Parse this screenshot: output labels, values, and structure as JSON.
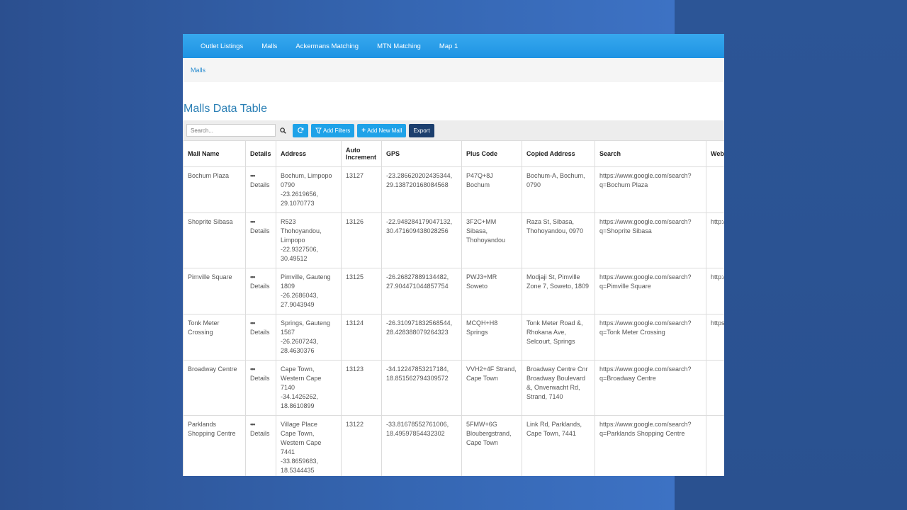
{
  "nav": {
    "items": [
      "Outlet Listings",
      "Malls",
      "Ackermans Matching",
      "MTN Matching",
      "Map 1"
    ]
  },
  "breadcrumb": "Malls",
  "page_title": "Malls Data Table",
  "toolbar": {
    "search_placeholder": "Search...",
    "add_filters": "Add Filters",
    "add_new_mall": "Add New Mall",
    "export": "Export"
  },
  "table": {
    "headers": [
      "Mall Name",
      "Details",
      "Address",
      "Auto Increment",
      "GPS",
      "Plus Code",
      "Copied Address",
      "Search",
      "Website"
    ],
    "rows": [
      {
        "mall_name": "Bochum Plaza",
        "details": "Details",
        "address": [
          "Bochum, Limpopo",
          "0790",
          "-23.2619656,",
          "29.1070773"
        ],
        "auto_increment": "13127",
        "gps": [
          "-23.286620202435344,",
          "29.138720168084568"
        ],
        "plus_code": [
          "P47Q+8J",
          "Bochum"
        ],
        "copied_address": [
          "Bochum-A, Bochum,",
          "0790"
        ],
        "search": [
          "https://www.google.com/search?",
          "q=Bochum Plaza"
        ],
        "website": ""
      },
      {
        "mall_name": "Shoprite Sibasa",
        "details": "Details",
        "address": [
          "R523",
          "Thohoyandou,",
          "Limpopo",
          "-22.9327506,",
          "30.49512"
        ],
        "auto_increment": "13126",
        "gps": [
          "-22.948284179047132,",
          "30.471609438028256"
        ],
        "plus_code": [
          "3F2C+MM",
          "Sibasa,",
          "Thohoyandou"
        ],
        "copied_address": [
          "Raza St, Sibasa,",
          "Thohoyandou, 0970"
        ],
        "search": [
          "https://www.google.com/search?",
          "q=Shoprite Sibasa"
        ],
        "website": "http:/"
      },
      {
        "mall_name": "Pimville Square",
        "details": "Details",
        "address": [
          "Pimville, Gauteng",
          "1809",
          "-26.2686043,",
          "27.9043949"
        ],
        "auto_increment": "13125",
        "gps": [
          "-26.26827889134482,",
          "27.904471044857754"
        ],
        "plus_code": [
          "PWJ3+MR",
          "Soweto"
        ],
        "copied_address": [
          "Modjaji St, Pimville",
          "Zone 7, Soweto, 1809"
        ],
        "search": [
          "https://www.google.com/search?",
          "q=Pimville Square"
        ],
        "website": "http:/"
      },
      {
        "mall_name": "Tonk Meter Crossing",
        "details": "Details",
        "address": [
          "Springs, Gauteng",
          "1567",
          "-26.2607243,",
          "28.4630376"
        ],
        "auto_increment": "13124",
        "gps": [
          "-26.310971832568544,",
          "28.428388079264323"
        ],
        "plus_code": [
          "MCQH+H8",
          "Springs"
        ],
        "copied_address": [
          "Tonk Meter Road &,",
          "Rhokana Ave,",
          "Selcourt, Springs"
        ],
        "search": [
          "https://www.google.com/search?",
          "q=Tonk Meter Crossing"
        ],
        "website": "https:"
      },
      {
        "mall_name": "Broadway Centre",
        "details": "Details",
        "address": [
          "Cape Town,",
          "Western Cape",
          "7140",
          "-34.1426262,",
          "18.8610899"
        ],
        "auto_increment": "13123",
        "gps": [
          "-34.12247853217184,",
          "18.851562794309572"
        ],
        "plus_code": [
          "VVH2+4F Strand,",
          "Cape Town"
        ],
        "copied_address": [
          "Broadway Centre Cnr",
          "Broadway Boulevard",
          "&, Onverwacht Rd,",
          "Strand, 7140"
        ],
        "search": [
          "https://www.google.com/search?",
          "q=Broadway Centre"
        ],
        "website": ""
      },
      {
        "mall_name": "Parklands Shopping Centre",
        "details": "Details",
        "address": [
          "Village Place",
          "Cape Town,",
          "Western Cape",
          "7441",
          "-33.8659683,",
          "18.5344435"
        ],
        "auto_increment": "13122",
        "gps": [
          "-33.81678552761006,",
          "18.49597854432302"
        ],
        "plus_code": [
          "5FMW+6G",
          "Bloubergstrand,",
          "Cape Town"
        ],
        "copied_address": [
          "Link Rd, Parklands,",
          "Cape Town, 7441"
        ],
        "search": [
          "https://www.google.com/search?",
          "q=Parklands Shopping Centre"
        ],
        "website": ""
      }
    ]
  },
  "colors": {
    "navbar": "#1e93e3",
    "title": "#2a7fb5",
    "button_blue": "#1ea2e8",
    "button_dark": "#1c3f6e"
  }
}
